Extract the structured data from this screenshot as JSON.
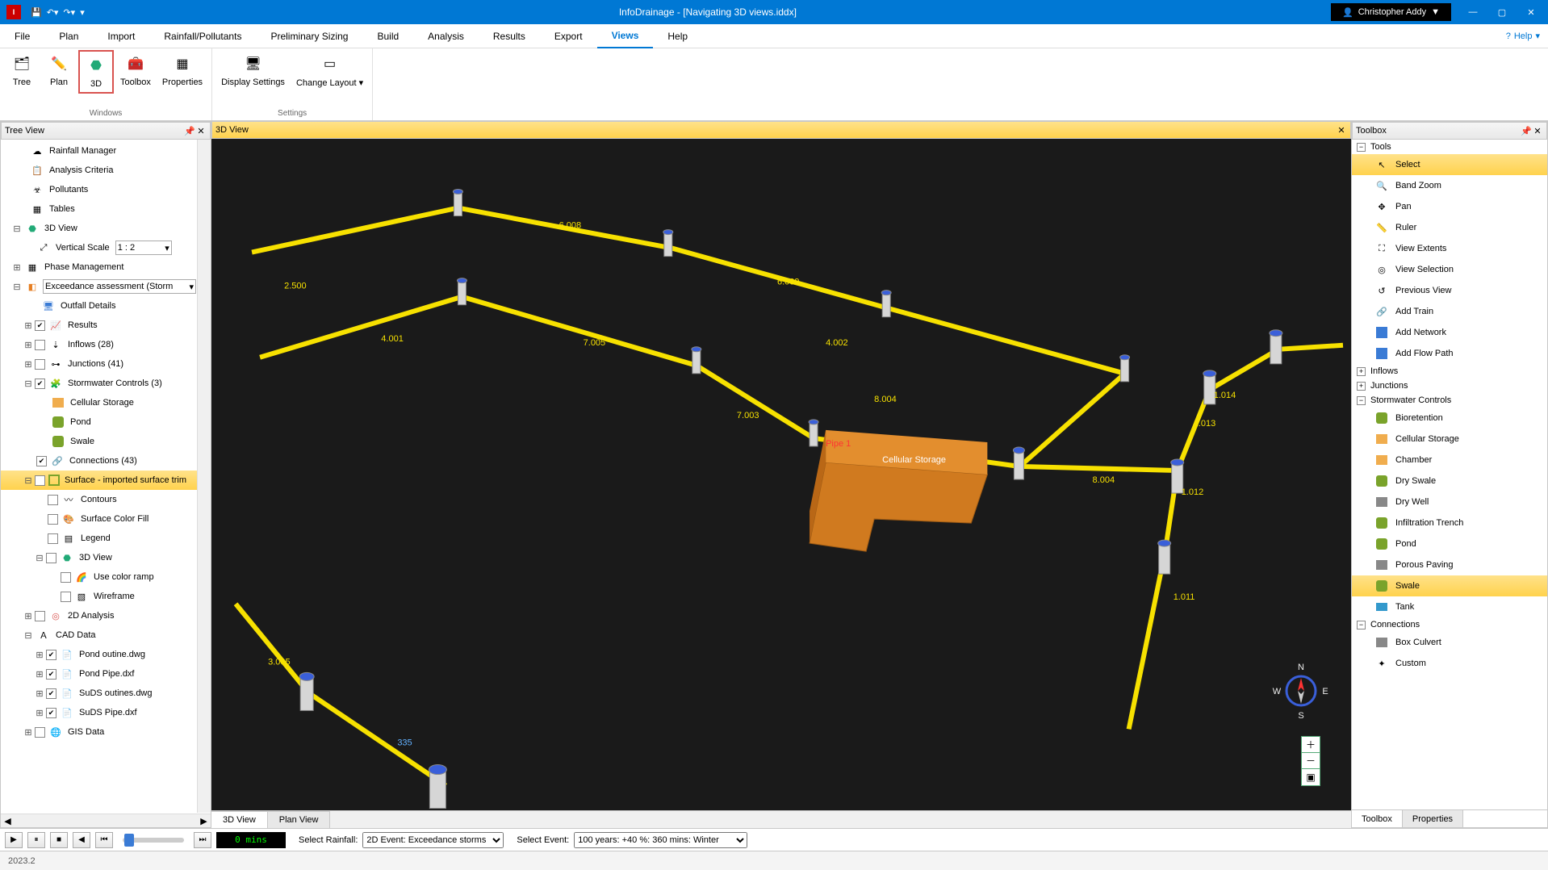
{
  "app": {
    "title": "InfoDrainage - [Navigating 3D views.iddx]"
  },
  "user": {
    "name": "Christopher Addy"
  },
  "menu": {
    "items": [
      "File",
      "Plan",
      "Import",
      "Rainfall/Pollutants",
      "Preliminary Sizing",
      "Build",
      "Analysis",
      "Results",
      "Export",
      "Views",
      "Help"
    ],
    "active": "Views",
    "help_label": "Help"
  },
  "ribbon": {
    "windows_group": "Windows",
    "settings_group": "Settings",
    "tree": "Tree",
    "plan": "Plan",
    "threeD": "3D",
    "toolbox": "Toolbox",
    "properties": "Properties",
    "display_settings": "Display Settings",
    "change_layout": "Change Layout"
  },
  "panels": {
    "tree_title": "Tree View",
    "view_title": "3D View",
    "toolbox_title": "Toolbox"
  },
  "tree": {
    "rainfall_manager": "Rainfall Manager",
    "analysis_criteria": "Analysis Criteria",
    "pollutants": "Pollutants",
    "tables": "Tables",
    "threeD_view": "3D View",
    "vertical_scale_label": "Vertical Scale",
    "vertical_scale_value": "1 : 2",
    "phase_management": "Phase Management",
    "exceedance_label": "Exceedance assessment (Storm",
    "outfall_details": "Outfall Details",
    "results": "Results",
    "inflows": "Inflows (28)",
    "junctions": "Junctions (41)",
    "swc": "Stormwater Controls (3)",
    "cellular_storage": "Cellular Storage",
    "pond": "Pond",
    "swale": "Swale",
    "connections": "Connections (43)",
    "surface": "Surface - imported surface trim",
    "contours": "Contours",
    "surface_color_fill": "Surface Color Fill",
    "legend": "Legend",
    "threeD_view2": "3D View",
    "use_color_ramp": "Use color ramp",
    "wireframe": "Wireframe",
    "twoD_analysis": "2D Analysis",
    "cad_data": "CAD Data",
    "pond_outline": "Pond outine.dwg",
    "pond_pipe": "Pond Pipe.dxf",
    "suds_outlines": "SuDS outines.dwg",
    "suds_pipe": "SuDS Pipe.dxf",
    "gis_data": "GIS Data"
  },
  "viewport": {
    "storage_label": "Cellular Storage",
    "tabs": {
      "threeD": "3D View",
      "plan": "Plan View"
    },
    "pipe_labels": [
      "2.500",
      "4.001",
      "6.008",
      "7.005",
      "6.009",
      "4.002",
      "8.004",
      "7.003",
      "8.004",
      "3.005",
      "1.011",
      "1.012",
      "1.013",
      "1.014",
      "335",
      "Pipe 1"
    ],
    "compass": {
      "n": "N",
      "e": "E",
      "s": "S",
      "w": "W"
    }
  },
  "toolbox": {
    "groups": {
      "tools": "Tools",
      "inflows": "Inflows",
      "junctions": "Junctions",
      "swc": "Stormwater Controls",
      "connections": "Connections"
    },
    "tools": {
      "select": "Select",
      "band_zoom": "Band Zoom",
      "pan": "Pan",
      "ruler": "Ruler",
      "view_extents": "View Extents",
      "view_selection": "View Selection",
      "previous_view": "Previous View",
      "add_train": "Add Train",
      "add_network": "Add Network",
      "add_flow_path": "Add Flow Path"
    },
    "swc": {
      "bioretention": "Bioretention",
      "cellular_storage": "Cellular Storage",
      "chamber": "Chamber",
      "dry_swale": "Dry Swale",
      "dry_well": "Dry Well",
      "infiltration_trench": "Infiltration Trench",
      "pond": "Pond",
      "porous_paving": "Porous Paving",
      "swale": "Swale",
      "tank": "Tank"
    },
    "connections": {
      "box_culvert": "Box Culvert",
      "custom": "Custom"
    },
    "tabs": {
      "toolbox": "Toolbox",
      "properties": "Properties"
    }
  },
  "playbar": {
    "time": "0 mins",
    "select_rainfall_label": "Select Rainfall:",
    "select_rainfall_value": "2D Event: Exceedance storms",
    "select_event_label": "Select Event:",
    "select_event_value": "100 years: +40 %: 360 mins: Winter"
  },
  "status": {
    "version": "2023.2"
  }
}
